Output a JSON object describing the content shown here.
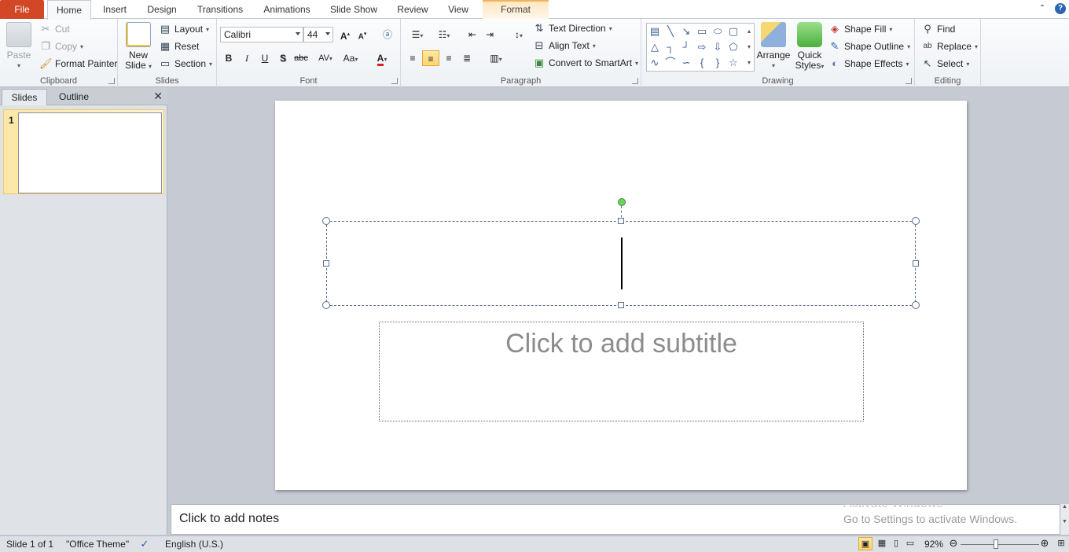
{
  "tabs": [
    "File",
    "Home",
    "Insert",
    "Design",
    "Transitions",
    "Animations",
    "Slide Show",
    "Review",
    "View",
    "Format"
  ],
  "ribbon": {
    "clipboard": {
      "label": "Clipboard",
      "paste": "Paste",
      "cut": "Cut",
      "copy": "Copy",
      "format_painter": "Format Painter"
    },
    "slides": {
      "label": "Slides",
      "new_slide": "New",
      "new_slide2": "Slide",
      "layout": "Layout",
      "reset": "Reset",
      "section": "Section"
    },
    "font": {
      "label": "Font",
      "name": "Calibri",
      "size": "44",
      "bold": "B",
      "italic": "I",
      "underline": "U",
      "shadow": "S",
      "strike": "abc",
      "spacing": "AV",
      "case": "Aa",
      "color": "A"
    },
    "paragraph": {
      "label": "Paragraph",
      "text_direction": "Text Direction",
      "align_text": "Align Text",
      "convert": "Convert to SmartArt"
    },
    "drawing": {
      "label": "Drawing",
      "arrange": "Arrange",
      "quick": "Quick",
      "styles": "Styles",
      "shape_fill": "Shape Fill",
      "shape_outline": "Shape Outline",
      "shape_effects": "Shape Effects"
    },
    "editing": {
      "label": "Editing",
      "find": "Find",
      "replace": "Replace",
      "select": "Select"
    }
  },
  "pane": {
    "tab_slides": "Slides",
    "tab_outline": "Outline",
    "thumb_num": "1"
  },
  "slide": {
    "subtitle_placeholder": "Click to add subtitle"
  },
  "notes": {
    "placeholder": "Click to add notes",
    "watermark_title": "Activate Windows",
    "watermark_sub": "Go to Settings to activate Windows."
  },
  "status": {
    "slide_info": "Slide 1 of 1",
    "theme": "\"Office Theme\"",
    "language": "English (U.S.)",
    "zoom": "92%"
  }
}
